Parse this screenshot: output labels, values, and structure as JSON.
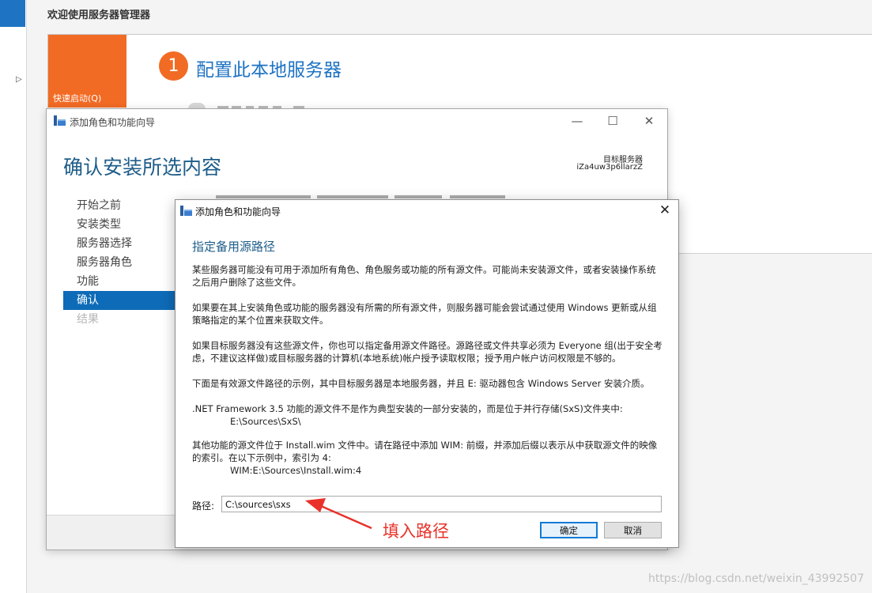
{
  "server_manager": {
    "welcome_title": "欢迎使用服务器管理器",
    "quick_start": "快速启动(Q)",
    "step1_number": "1",
    "step1_title": "配置此本地服务器",
    "watermark": "https://blog.csdn.net/weixin_43992507",
    "accent_color": "#f26b24"
  },
  "wizard_main": {
    "title": "添加角色和功能向导",
    "heading": "确认安装所选内容",
    "target_label": "目标服务器",
    "target_value": "iZa4uw3p6llarzZ",
    "nav": [
      {
        "label": "开始之前",
        "state": "normal"
      },
      {
        "label": "安装类型",
        "state": "normal"
      },
      {
        "label": "服务器选择",
        "state": "normal"
      },
      {
        "label": "服务器角色",
        "state": "normal"
      },
      {
        "label": "功能",
        "state": "normal"
      },
      {
        "label": "确认",
        "state": "active"
      },
      {
        "label": "结果",
        "state": "disabled"
      }
    ],
    "window_controls": {
      "minimize": "—",
      "maximize": "☐",
      "close": "✕"
    }
  },
  "dialog": {
    "title": "添加角色和功能向导",
    "close": "✕",
    "heading": "指定备用源路径",
    "para1": "某些服务器可能没有可用于添加所有角色、角色服务或功能的所有源文件。可能尚未安装源文件，或者安装操作系统之后用户删除了这些文件。",
    "para2": "如果要在其上安装角色或功能的服务器没有所需的所有源文件，则服务器可能会尝试通过使用 Windows 更新或从组策略指定的某个位置来获取文件。",
    "para3": "如果目标服务器没有这些源文件，你也可以指定备用源文件路径。源路径或文件共享必须为 Everyone 组(出于安全考虑，不建议这样做)或目标服务器的计算机(本地系统)帐户授予读取权限；授予用户帐户访问权限是不够的。",
    "para4": "下面是有效源文件路径的示例，其中目标服务器是本地服务器，并且 E: 驱动器包含 Windows Server 安装介质。",
    "para5": ".NET Framework 3.5 功能的源文件不是作为典型安装的一部分安装的，而是位于并行存储(SxS)文件夹中:",
    "example1": "E:\\Sources\\SxS\\",
    "para6": "其他功能的源文件位于 Install.wim 文件中。请在路径中添加 WIM: 前缀，并添加后缀以表示从中获取源文件的映像的索引。在以下示例中，索引为 4:",
    "example2": "WIM:E:\\Sources\\Install.wim:4",
    "path_label": "路径:",
    "path_value": "C:\\sources\\sxs",
    "ok": "确定",
    "cancel": "取消"
  },
  "annotation": {
    "text": "填入路径",
    "color": "#e8322a"
  }
}
